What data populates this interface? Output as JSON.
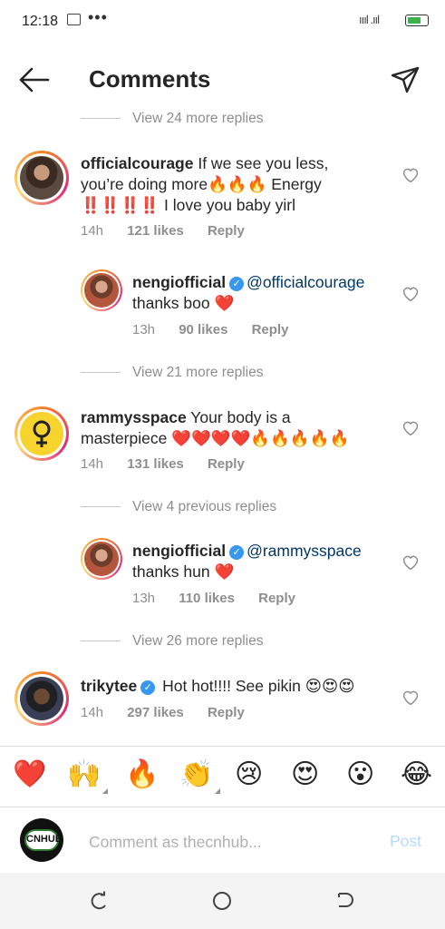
{
  "status_bar": {
    "time": "12:18",
    "dots": "•••",
    "signal": "ıııl .ııl"
  },
  "header": {
    "title": "Comments"
  },
  "threads": {
    "more1": "View 24 more replies",
    "c1": {
      "username": "officialcourage",
      "text": " If we see you less, you’re doing more🔥🔥🔥 Energy ‼️‼️‼️‼️ I love you baby yirl",
      "time": "14h",
      "likes": "121 likes",
      "reply": "Reply"
    },
    "r1": {
      "username": "nengiofficial",
      "mention": "@officialcourage",
      "text": " thanks boo ❤️",
      "time": "13h",
      "likes": "90 likes",
      "reply": "Reply"
    },
    "more2": "View 21 more replies",
    "c2": {
      "username": "rammysspace",
      "text": " Your body is a masterpiece ❤️❤️❤️❤️🔥🔥🔥🔥🔥",
      "time": "14h",
      "likes": "131 likes",
      "reply": "Reply"
    },
    "more3": "View 4 previous replies",
    "r2": {
      "username": "nengiofficial",
      "mention": "@rammysspace",
      "text": " thanks hun ❤️",
      "time": "13h",
      "likes": "110 likes",
      "reply": "Reply"
    },
    "more4": "View 26 more replies",
    "c3": {
      "username": "trikytee",
      "text": " Hot hot!!!! See pikin 😍😍😍",
      "time": "14h",
      "likes": "297 likes",
      "reply": "Reply"
    }
  },
  "emoji_bar": [
    "❤️",
    "🙌",
    "🔥",
    "👏",
    "😢",
    "😍",
    "😮",
    "😂"
  ],
  "composer": {
    "avatar_text": "CNHUB",
    "placeholder": "Comment as thecnhub...",
    "post": "Post"
  },
  "colors": {
    "accent": "#3897f0",
    "heart": "#ed4956",
    "post_disabled": "#b3dbff"
  }
}
